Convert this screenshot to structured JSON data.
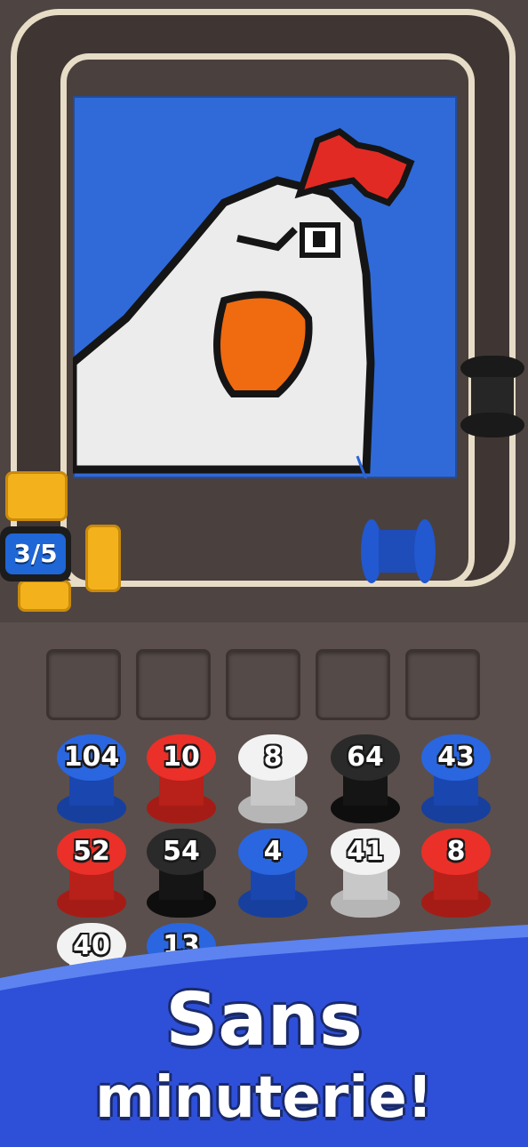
{
  "level_counter": {
    "text": "3/5"
  },
  "colors": {
    "blue": "#2258d0",
    "red": "#e22a24",
    "white": "#e8e8e8",
    "black": "#1e1e1e",
    "orange": "#f06a10",
    "clamp": "#f3b21c"
  },
  "spools": [
    {
      "count": "104",
      "color": "blue"
    },
    {
      "count": "10",
      "color": "red"
    },
    {
      "count": "8",
      "color": "white"
    },
    {
      "count": "64",
      "color": "black"
    },
    {
      "count": "43",
      "color": "blue"
    },
    {
      "count": "52",
      "color": "red"
    },
    {
      "count": "54",
      "color": "black"
    },
    {
      "count": "4",
      "color": "blue"
    },
    {
      "count": "41",
      "color": "white"
    },
    {
      "count": "8",
      "color": "red"
    },
    {
      "count": "40",
      "color": "white"
    },
    {
      "count": "13",
      "color": "blue"
    }
  ],
  "slots_count": 5,
  "banner": {
    "line1": "Sans",
    "line2": "minuterie!"
  }
}
